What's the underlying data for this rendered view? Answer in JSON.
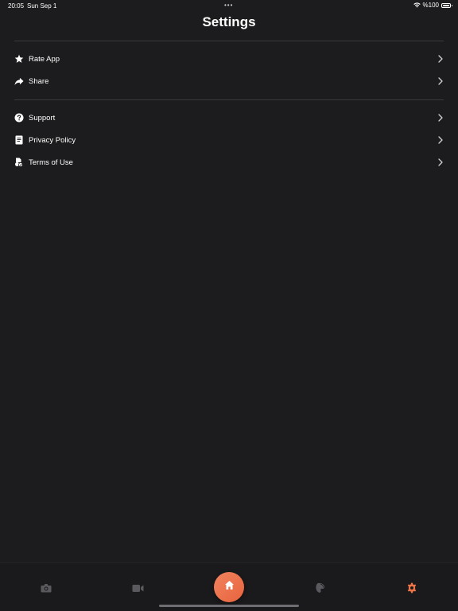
{
  "status_bar": {
    "time": "20:05",
    "date": "Sun Sep 1",
    "battery": "%100",
    "multitask_dots": "•••"
  },
  "header": {
    "title": "Settings"
  },
  "sections": [
    {
      "items": [
        {
          "label": "Rate App",
          "icon": "star-icon"
        },
        {
          "label": "Share",
          "icon": "share-arrow-icon"
        }
      ]
    },
    {
      "items": [
        {
          "label": "Support",
          "icon": "question-circle-icon"
        },
        {
          "label": "Privacy Policy",
          "icon": "document-icon"
        },
        {
          "label": "Terms of Use",
          "icon": "terms-icon"
        }
      ]
    }
  ],
  "tab_bar": {
    "tabs": [
      {
        "icon": "camera-icon",
        "active": false
      },
      {
        "icon": "video-icon",
        "active": false
      },
      {
        "icon": "home-icon",
        "active": false
      },
      {
        "icon": "palette-icon",
        "active": false
      },
      {
        "icon": "gear-icon",
        "active": true
      }
    ]
  },
  "colors": {
    "background": "#1c1c1e",
    "accent": "#ee7447",
    "inactive_icon": "#5a5a5e",
    "divider": "#3a3a3c"
  }
}
